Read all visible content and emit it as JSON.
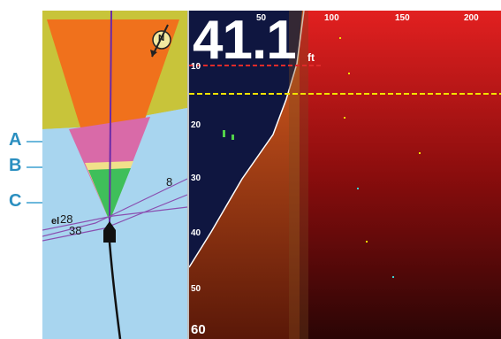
{
  "callouts": {
    "a": "A",
    "b": "B",
    "c": "C"
  },
  "chart": {
    "depth_labels": [
      "8",
      "28",
      "38"
    ],
    "prefix_label": "el",
    "compass_label": "N",
    "colors": {
      "water": "#a8d5ef",
      "land": "#c8c43a",
      "beam_outer": "#f0711c",
      "beam_mid": "#d96aa8",
      "beam_band": "#f0e08a",
      "beam_inner": "#3fbf5a"
    }
  },
  "sonar": {
    "depth_value": "41.1",
    "depth_unit": "ft",
    "range_ticks": [
      "50",
      "100",
      "150",
      "200"
    ],
    "depth_ticks": [
      "10",
      "20",
      "30",
      "40",
      "50",
      "60"
    ],
    "colors": {
      "water_column": "#0f1640",
      "returns": "#8a0d0d",
      "bottom": "#d8541c",
      "depth_line": "#e02a2a",
      "cursor_line": "#f2e200"
    }
  }
}
